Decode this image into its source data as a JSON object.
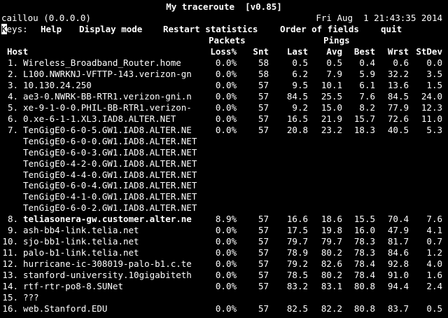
{
  "header": {
    "title": "My traceroute  [v0.85]",
    "host": "caillou (0.0.0.0)",
    "datetime": "Fri Aug  1 21:43:35 2014"
  },
  "keys": {
    "prefix_cursor": "K",
    "prefix_rest": "eys:",
    "help": "Help",
    "display": "Display mode",
    "restart": "Restart statistics",
    "order": "Order of fields",
    "quit": "quit"
  },
  "columns": {
    "packets_group": "Packets",
    "pings_group": "Pings",
    "host": "Host",
    "loss": "Loss%",
    "snt": "Snt",
    "last": "Last",
    "avg": "Avg",
    "best": "Best",
    "wrst": "Wrst",
    "stdev": "StDev"
  },
  "rows": [
    {
      "n": "1.",
      "host": "Wireless_Broadband_Router.home",
      "loss": "0.0%",
      "snt": "58",
      "last": "0.5",
      "avg": "0.5",
      "best": "0.4",
      "wrst": "0.6",
      "stdev": "0.0"
    },
    {
      "n": "2.",
      "host": "L100.NWRKNJ-VFTTP-143.verizon-gn",
      "loss": "0.0%",
      "snt": "58",
      "last": "6.2",
      "avg": "7.9",
      "best": "5.9",
      "wrst": "32.2",
      "stdev": "3.5"
    },
    {
      "n": "3.",
      "host": "10.130.24.250",
      "loss": "0.0%",
      "snt": "57",
      "last": "9.5",
      "avg": "10.1",
      "best": "6.1",
      "wrst": "13.6",
      "stdev": "1.5"
    },
    {
      "n": "4.",
      "host": "ae3-0.NWRK-BB-RTR1.verizon-gni.n",
      "loss": "0.0%",
      "snt": "57",
      "last": "84.5",
      "avg": "25.5",
      "best": "7.6",
      "wrst": "84.5",
      "stdev": "24.0"
    },
    {
      "n": "5.",
      "host": "xe-9-1-0-0.PHIL-BB-RTR1.verizon-",
      "loss": "0.0%",
      "snt": "57",
      "last": "9.2",
      "avg": "15.0",
      "best": "8.2",
      "wrst": "77.9",
      "stdev": "12.3"
    },
    {
      "n": "6.",
      "host": "0.xe-6-1-1.XL3.IAD8.ALTER.NET",
      "loss": "0.0%",
      "snt": "57",
      "last": "16.5",
      "avg": "21.9",
      "best": "15.7",
      "wrst": "72.6",
      "stdev": "11.0"
    },
    {
      "n": "7.",
      "host": "TenGigE0-6-0-5.GW1.IAD8.ALTER.NE",
      "loss": "0.0%",
      "snt": "57",
      "last": "20.8",
      "avg": "23.2",
      "best": "18.3",
      "wrst": "40.5",
      "stdev": "5.3"
    },
    {
      "n": "",
      "host": "TenGigE0-6-0-0.GW1.IAD8.ALTER.NET",
      "loss": "",
      "snt": "",
      "last": "",
      "avg": "",
      "best": "",
      "wrst": "",
      "stdev": ""
    },
    {
      "n": "",
      "host": "TenGigE0-6-0-3.GW1.IAD8.ALTER.NET",
      "loss": "",
      "snt": "",
      "last": "",
      "avg": "",
      "best": "",
      "wrst": "",
      "stdev": ""
    },
    {
      "n": "",
      "host": "TenGigE0-4-2-0.GW1.IAD8.ALTER.NET",
      "loss": "",
      "snt": "",
      "last": "",
      "avg": "",
      "best": "",
      "wrst": "",
      "stdev": ""
    },
    {
      "n": "",
      "host": "TenGigE0-4-4-0.GW1.IAD8.ALTER.NET",
      "loss": "",
      "snt": "",
      "last": "",
      "avg": "",
      "best": "",
      "wrst": "",
      "stdev": ""
    },
    {
      "n": "",
      "host": "TenGigE0-6-0-4.GW1.IAD8.ALTER.NET",
      "loss": "",
      "snt": "",
      "last": "",
      "avg": "",
      "best": "",
      "wrst": "",
      "stdev": ""
    },
    {
      "n": "",
      "host": "TenGigE0-4-1-0.GW1.IAD8.ALTER.NET",
      "loss": "",
      "snt": "",
      "last": "",
      "avg": "",
      "best": "",
      "wrst": "",
      "stdev": ""
    },
    {
      "n": "",
      "host": "TenGigE0-6-0-2.GW1.IAD8.ALTER.NET",
      "loss": "",
      "snt": "",
      "last": "",
      "avg": "",
      "best": "",
      "wrst": "",
      "stdev": ""
    },
    {
      "n": "8.",
      "host": "teliasonera-gw.customer.alter.ne",
      "bold": true,
      "loss": "8.9%",
      "snt": "57",
      "last": "16.6",
      "avg": "18.6",
      "best": "15.5",
      "wrst": "70.4",
      "stdev": "7.6"
    },
    {
      "n": "9.",
      "host": "ash-bb4-link.telia.net",
      "loss": "0.0%",
      "snt": "57",
      "last": "17.5",
      "avg": "19.8",
      "best": "16.0",
      "wrst": "47.9",
      "stdev": "4.1"
    },
    {
      "n": "10.",
      "host": "sjo-bb1-link.telia.net",
      "loss": "0.0%",
      "snt": "57",
      "last": "79.7",
      "avg": "79.7",
      "best": "78.3",
      "wrst": "81.7",
      "stdev": "0.7"
    },
    {
      "n": "11.",
      "host": "palo-b1-link.telia.net",
      "loss": "0.0%",
      "snt": "57",
      "last": "78.9",
      "avg": "80.2",
      "best": "78.3",
      "wrst": "84.6",
      "stdev": "1.2"
    },
    {
      "n": "12.",
      "host": "hurricane-ic-308019-palo-b1.c.te",
      "loss": "0.0%",
      "snt": "57",
      "last": "79.2",
      "avg": "82.6",
      "best": "78.4",
      "wrst": "92.8",
      "stdev": "4.0"
    },
    {
      "n": "13.",
      "host": "stanford-university.10gigabiteth",
      "loss": "0.0%",
      "snt": "57",
      "last": "78.5",
      "avg": "80.2",
      "best": "78.4",
      "wrst": "91.0",
      "stdev": "1.6"
    },
    {
      "n": "14.",
      "host": "rtf-rtr-po8-8.SUNet",
      "loss": "0.0%",
      "snt": "57",
      "last": "83.2",
      "avg": "83.1",
      "best": "80.8",
      "wrst": "94.4",
      "stdev": "2.4"
    },
    {
      "n": "15.",
      "host": "???",
      "loss": "",
      "snt": "",
      "last": "",
      "avg": "",
      "best": "",
      "wrst": "",
      "stdev": ""
    },
    {
      "n": "16.",
      "host": "web.Stanford.EDU",
      "loss": "0.0%",
      "snt": "57",
      "last": "82.5",
      "avg": "82.2",
      "best": "80.8",
      "wrst": "83.7",
      "stdev": "0.5"
    }
  ]
}
